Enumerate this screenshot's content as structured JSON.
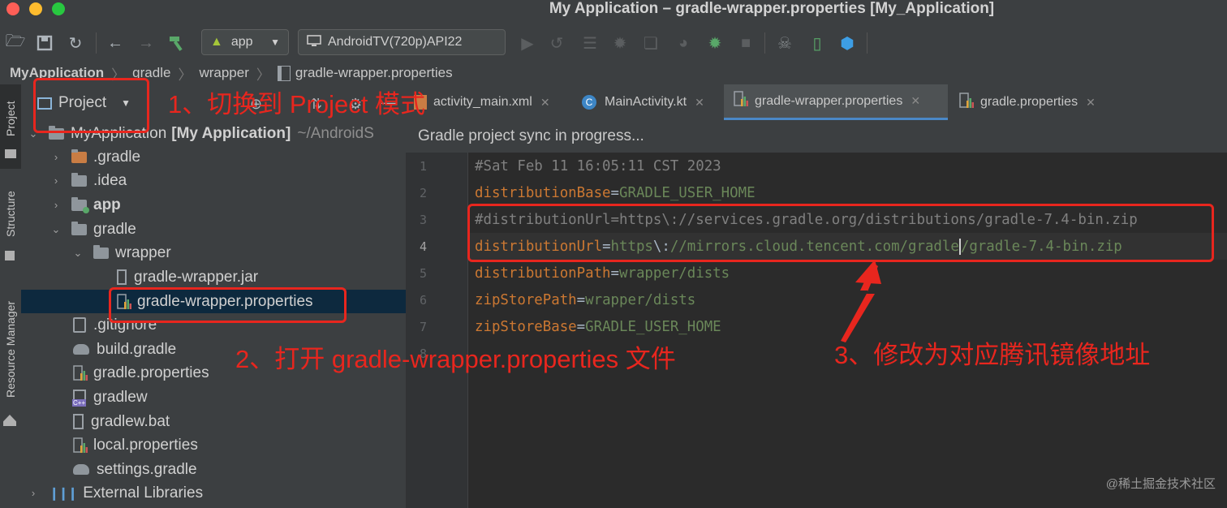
{
  "window": {
    "title": "My Application – gradle-wrapper.properties [My_Application]"
  },
  "toolbar": {
    "run_config": "app",
    "device": "AndroidTV(720p)API22"
  },
  "breadcrumb": [
    "MyApplication",
    "gradle",
    "wrapper",
    "gradle-wrapper.properties"
  ],
  "side_tabs": {
    "project": "Project",
    "structure": "Structure",
    "resource_manager": "Resource Manager"
  },
  "project_panel": {
    "view_mode": "Project",
    "root": {
      "name": "MyApplication",
      "module": "[My Application]",
      "path": "~/AndroidS"
    },
    "items": [
      {
        "label": ".gradle"
      },
      {
        "label": ".idea"
      },
      {
        "label": "app"
      },
      {
        "label": "gradle"
      },
      {
        "label": "wrapper"
      },
      {
        "label": "gradle-wrapper.jar"
      },
      {
        "label": "gradle-wrapper.properties"
      },
      {
        "label": ".gitignore"
      },
      {
        "label": "build.gradle"
      },
      {
        "label": "gradle.properties"
      },
      {
        "label": "gradlew"
      },
      {
        "label": "gradlew.bat"
      },
      {
        "label": "local.properties"
      },
      {
        "label": "settings.gradle"
      },
      {
        "label": "External Libraries"
      }
    ]
  },
  "editor": {
    "tabs": [
      {
        "label": "activity_main.xml"
      },
      {
        "label": "MainActivity.kt"
      },
      {
        "label": "gradle-wrapper.properties",
        "active": true
      },
      {
        "label": "gradle.properties"
      }
    ],
    "sync_message": "Gradle project sync in progress...",
    "line_numbers": [
      "1",
      "2",
      "3",
      "4",
      "5",
      "6",
      "7",
      "8"
    ],
    "lines": [
      {
        "comment": "#Sat Feb 11 16:05:11 CST 2023"
      },
      {
        "key": "distributionBase",
        "eq": "=",
        "value": "GRADLE_USER_HOME"
      },
      {
        "comment": "#distributionUrl=https\\://services.gradle.org/distributions/gradle-7.4-bin.zip"
      },
      {
        "key": "distributionUrl",
        "eq": "=",
        "v1": "https",
        "esc": "\\:",
        "v2": "//mirrors.cloud.tencent.com/gradle",
        "v3": "/gradle-7.4-bin.zip"
      },
      {
        "key": "distributionPath",
        "eq": "=",
        "value": "wrapper/dists"
      },
      {
        "key": "zipStorePath",
        "eq": "=",
        "value": "wrapper/dists"
      },
      {
        "key": "zipStoreBase",
        "eq": "=",
        "value": "GRADLE_USER_HOME"
      }
    ]
  },
  "annotations": {
    "step1": "1、切换到 Project 模式",
    "step2": "2、打开 gradle-wrapper.properties 文件",
    "step3": "3、修改为对应腾讯镜像地址"
  },
  "watermark": "@稀土掘金技术社区",
  "colors": {
    "annotation_red": "#e8261e",
    "selection": "#0d293e",
    "keyword": "#cc7832",
    "string": "#6a8759",
    "comment": "#808080"
  }
}
